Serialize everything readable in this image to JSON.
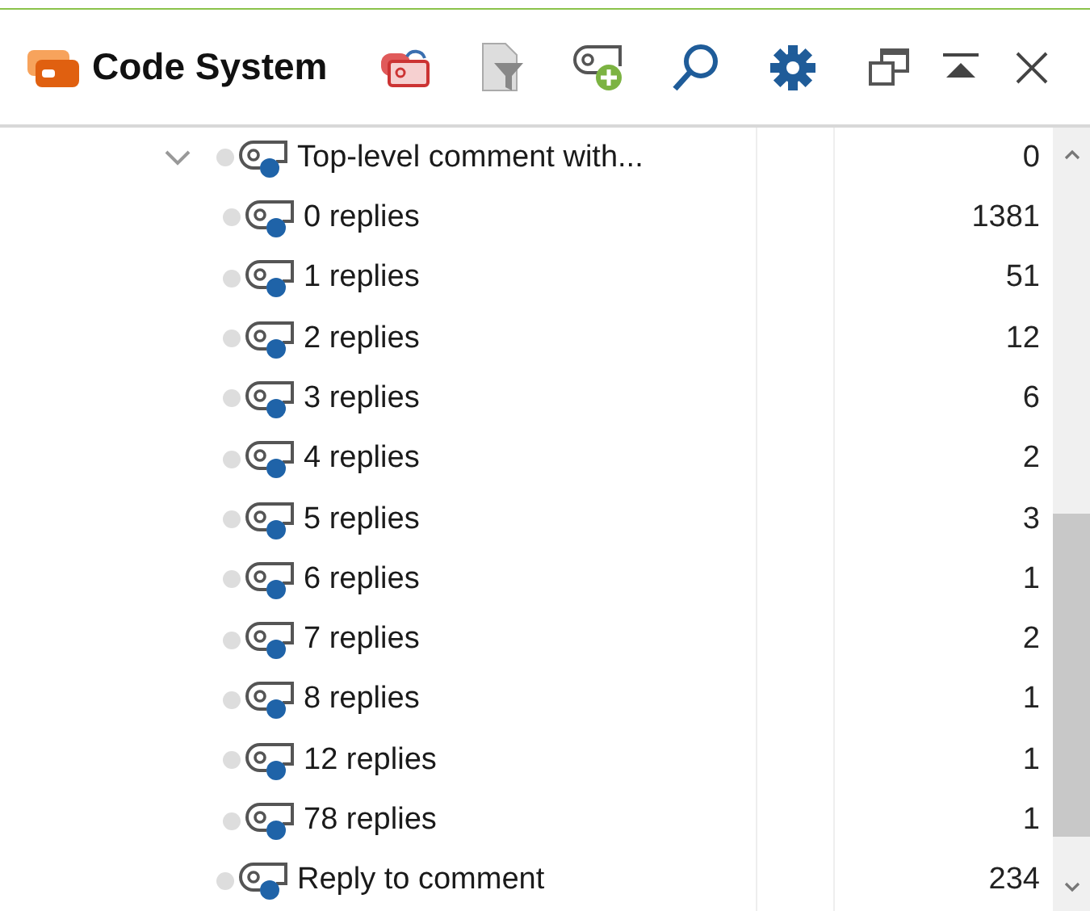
{
  "panel": {
    "title": "Code System"
  },
  "tree": [
    {
      "label": "Top-level comment with...",
      "count": "0",
      "expanded": true,
      "children": [
        {
          "label": "0 replies",
          "count": "1381"
        },
        {
          "label": "1 replies",
          "count": "51"
        },
        {
          "label": "2 replies",
          "count": "12"
        },
        {
          "label": "3 replies",
          "count": "6"
        },
        {
          "label": "4 replies",
          "count": "2"
        },
        {
          "label": "5 replies",
          "count": "3"
        },
        {
          "label": "6 replies",
          "count": "1"
        },
        {
          "label": "7 replies",
          "count": "2"
        },
        {
          "label": "8 replies",
          "count": "1"
        },
        {
          "label": "12 replies",
          "count": "1"
        },
        {
          "label": "78 replies",
          "count": "1"
        }
      ]
    },
    {
      "label": "Reply to comment",
      "count": "234"
    }
  ]
}
